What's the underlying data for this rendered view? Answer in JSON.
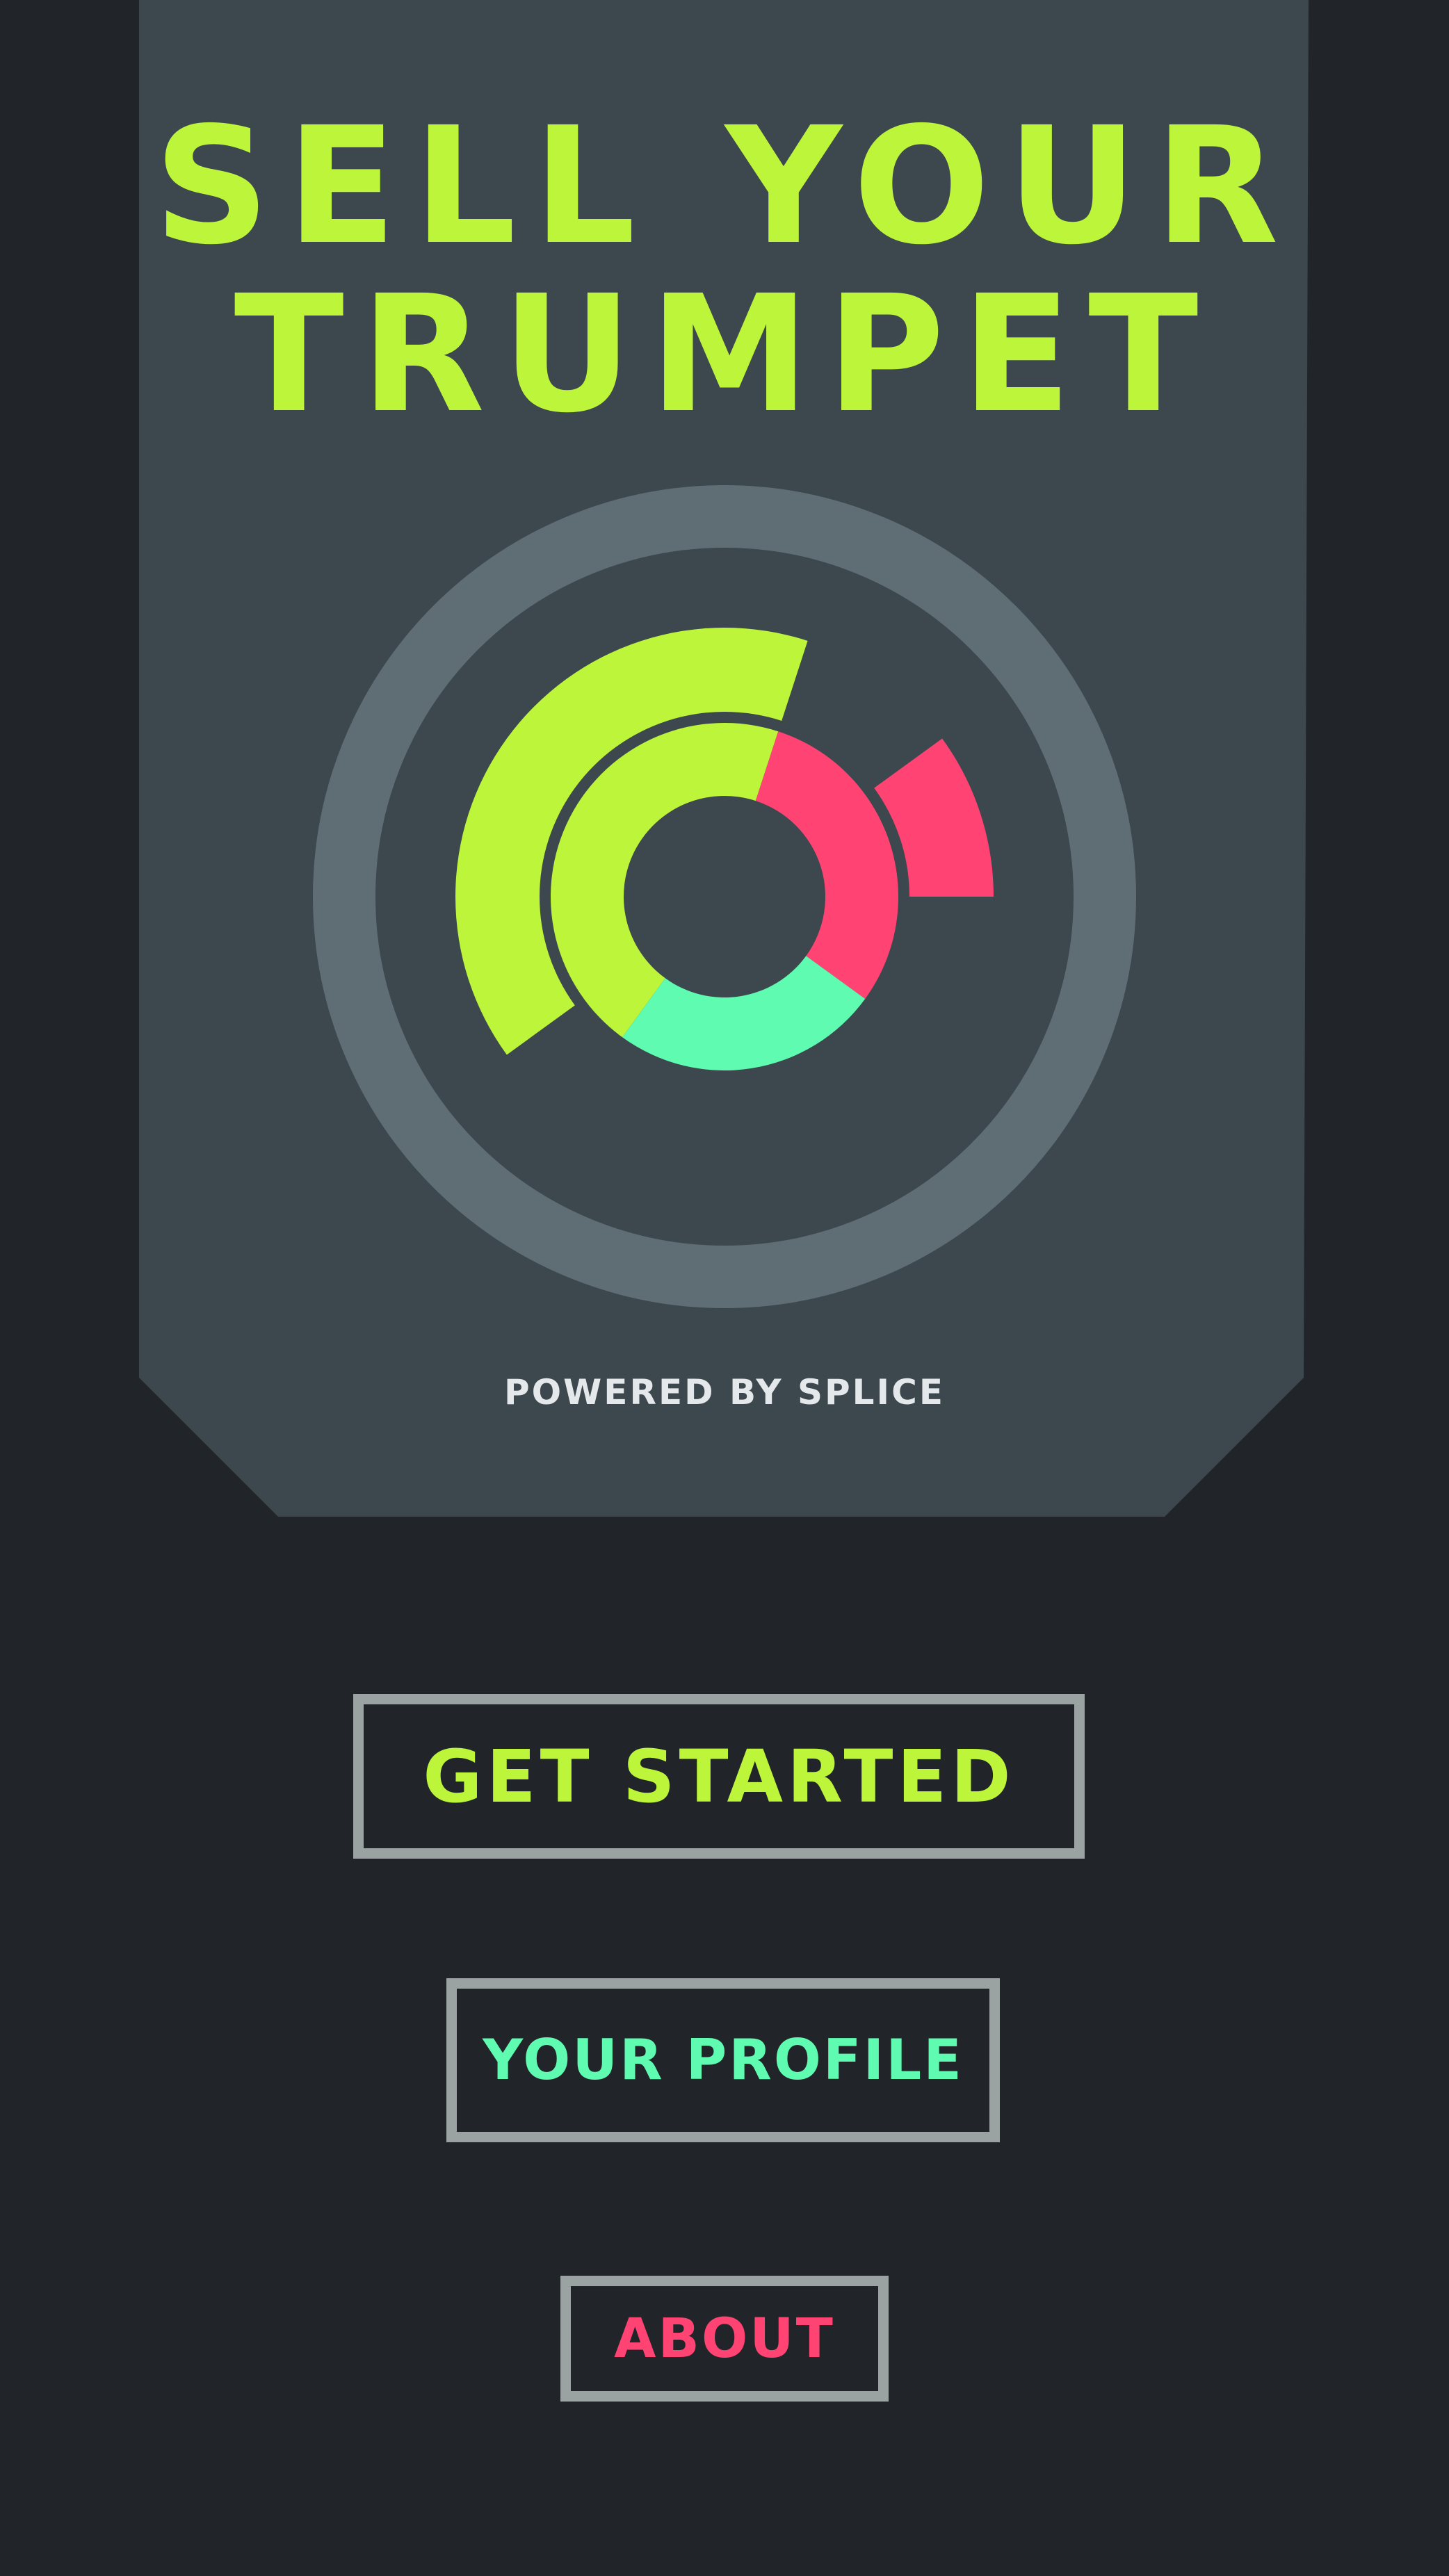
{
  "header": {
    "title_line_1": "SELL YOUR",
    "title_line_2": "TRUMPET",
    "title_color": "#bdf53a"
  },
  "dial": {
    "ring_color": "#5f6e74",
    "segments": [
      {
        "color_name": "lime",
        "color": "#bdf53a"
      },
      {
        "color_name": "pink",
        "color": "#ff4373"
      },
      {
        "color_name": "mint",
        "color": "#5ffbb0"
      }
    ]
  },
  "footer": {
    "powered_by": "POWERED BY SPLICE"
  },
  "menu": {
    "border_color": "#9aa3a2",
    "buttons": [
      {
        "label": "GET STARTED",
        "color": "#bdf53a"
      },
      {
        "label": "YOUR PROFILE",
        "color": "#5ffbb0"
      },
      {
        "label": "ABOUT",
        "color": "#ff4373"
      }
    ]
  },
  "colors": {
    "background": "#212529",
    "panel": "#3c474e"
  }
}
